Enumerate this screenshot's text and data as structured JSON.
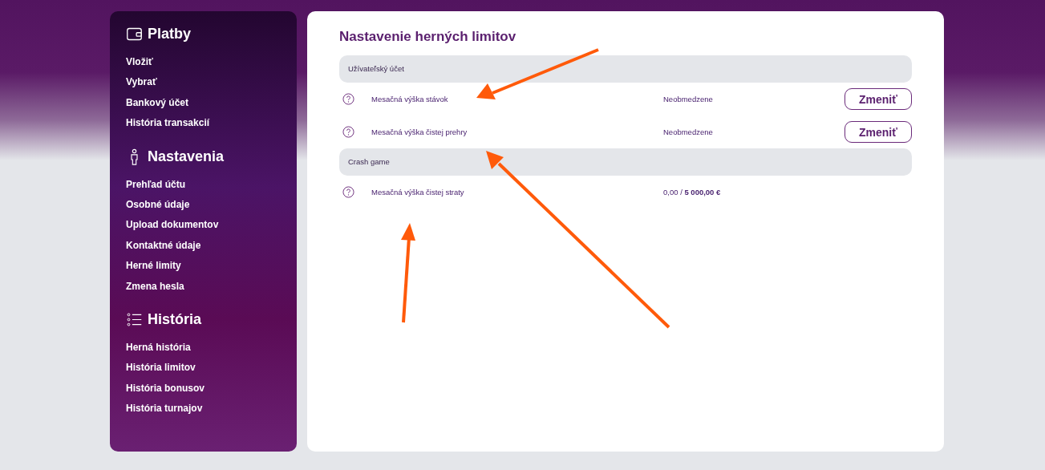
{
  "sidebar": {
    "sections": [
      {
        "title": "Platby",
        "items": [
          "Vložiť",
          "Vybrať",
          "Bankový účet",
          "História transakcií"
        ]
      },
      {
        "title": "Nastavenia",
        "items": [
          "Prehľad účtu",
          "Osobné údaje",
          "Upload dokumentov",
          "Kontaktné údaje",
          "Herné limity",
          "Zmena hesla"
        ]
      },
      {
        "title": "História",
        "items": [
          "Herná história",
          "História limitov",
          "História bonusov",
          "História turnajov"
        ]
      }
    ]
  },
  "content": {
    "title": "Nastavenie herných limitov",
    "groups": [
      {
        "title": "Užívateľský účet",
        "rows": [
          {
            "label": "Mesačná výška stávok",
            "value": "Neobmedzene",
            "button": "Zmeniť"
          },
          {
            "label": "Mesačná výška čistej prehry",
            "value": "Neobmedzene",
            "button": "Zmeniť"
          }
        ]
      },
      {
        "title": "Crash game",
        "rows": [
          {
            "label": "Mesačná výška čistej straty",
            "value": "0,00 / **5 000,00 €**"
          }
        ]
      }
    ]
  }
}
